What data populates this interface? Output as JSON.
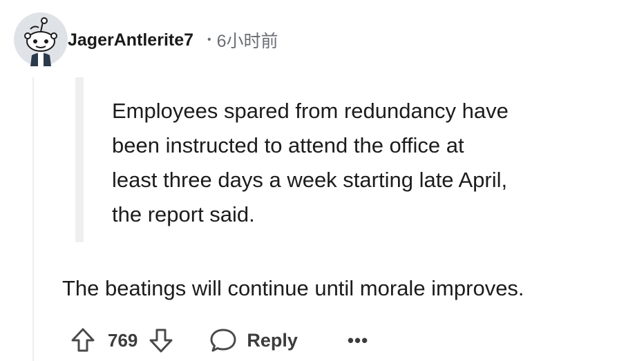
{
  "comment": {
    "author": "JagerAntlerite7",
    "separator": "•",
    "time": "6小时前",
    "quote_lines": [
      "Employees spared from redundancy have",
      "been instructed to attend the office at",
      "least three days a week starting late April,",
      "the report said."
    ],
    "body": "The beatings will continue until morale improves."
  },
  "actions": {
    "upvote_icon": "arrow-up-icon",
    "vote_count": "769",
    "downvote_icon": "arrow-down-icon",
    "reply_icon": "speech-bubble-icon",
    "reply_label": "Reply",
    "more_label": "•••"
  },
  "colors": {
    "text": "#1c1c1c",
    "meta": "#6a6e73",
    "quote_bar": "#efefef",
    "thread_line": "#ededed"
  }
}
